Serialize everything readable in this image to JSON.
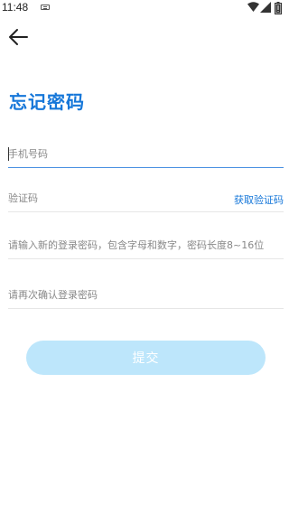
{
  "status_bar": {
    "time": "11:48",
    "icons": [
      "keyboard-icon",
      "wifi-icon",
      "signal-icon",
      "battery-icon"
    ]
  },
  "header": {
    "back_icon": "arrow-left-icon",
    "title": "忘记密码"
  },
  "form": {
    "phone_placeholder": "手机号码",
    "phone_value": "",
    "code_placeholder": "验证码",
    "code_value": "",
    "get_code_label": "获取验证码",
    "password_placeholder": "请输入新的登录密码，包含字母和数字，密码长度8~16位",
    "password_value": "",
    "confirm_placeholder": "请再次确认登录密码",
    "confirm_value": "",
    "submit_label": "提交"
  },
  "colors": {
    "accent": "#1677d9",
    "active_underline": "#4a90e2",
    "submit_disabled_bg": "#bde6fb",
    "divider": "#e6e6e6"
  }
}
